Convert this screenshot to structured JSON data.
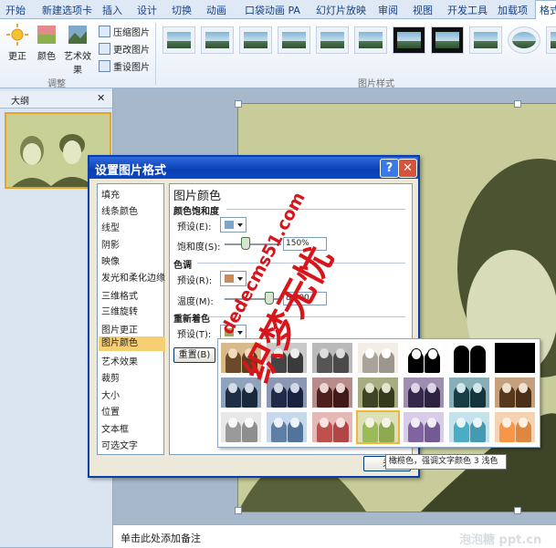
{
  "ribbon": {
    "tabs": [
      "开始",
      "新建选项卡",
      "插入",
      "设计",
      "切换",
      "动画",
      "口袋动画 PA",
      "幻灯片放映",
      "审阅",
      "视图",
      "开发工具",
      "加载项",
      "格式"
    ],
    "adjust": {
      "correct": "更正",
      "color": "颜色",
      "artistic": "艺术效果",
      "compress": "压缩图片",
      "change": "更改图片",
      "reset": "重设图片",
      "group_label": "调整"
    },
    "styles_group_label": "图片样式"
  },
  "left_panel": {
    "tab_label": "大纲",
    "close": "✕"
  },
  "dialog": {
    "title": "设置图片格式",
    "help": "?",
    "close": "✕",
    "categories": [
      "填充",
      "线条颜色",
      "线型",
      "阴影",
      "映像",
      "发光和柔化边缘",
      "三维格式",
      "三维旋转",
      "图片更正",
      "图片颜色",
      "艺术效果",
      "裁剪",
      "大小",
      "位置",
      "文本框",
      "可选文字"
    ],
    "selected_category": "图片颜色",
    "heading": "图片颜色",
    "saturation": {
      "section": "颜色饱和度",
      "preset": "预设(E):",
      "label": "饱和度(S):",
      "value": "150%"
    },
    "tone": {
      "section": "色调",
      "preset": "预设(R):",
      "label": "温度(M):",
      "value": "8,900"
    },
    "recolor": {
      "section": "重新着色",
      "preset": "预设(T):"
    },
    "reset_button": "重置(B)",
    "close_button": "关"
  },
  "tooltip": "橄榄色，强调文字颜色 3 浅色",
  "notes_placeholder": "单击此处添加备注",
  "watermarks": {
    "main": "织梦无忧",
    "url": "dedecms51.com",
    "corner": "泡泡糖 ppt.cn"
  },
  "colors": {
    "sepia_bg": "#c7cc9a",
    "selection": "#f1b63a",
    "title_bar": "#0a3fb3"
  }
}
